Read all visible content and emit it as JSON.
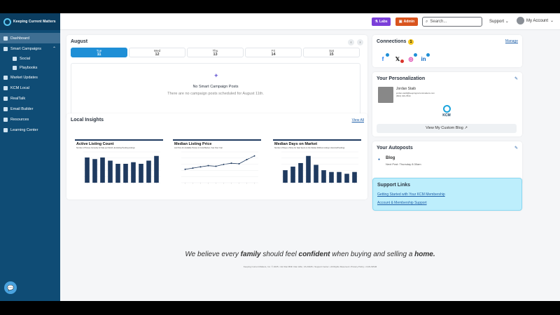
{
  "app": {
    "logo_text": "Keeping Current Matters"
  },
  "sidebar": {
    "items": [
      {
        "label": "Dashboard",
        "icon": "dashboard-icon"
      },
      {
        "label": "Smart Campaigns",
        "icon": "campaign-icon"
      },
      {
        "label": "Social",
        "icon": "social-icon"
      },
      {
        "label": "Playbooks",
        "icon": "playbook-icon"
      },
      {
        "label": "Market Updates",
        "icon": "market-icon"
      },
      {
        "label": "KCM Local",
        "icon": "location-icon"
      },
      {
        "label": "RealTalk",
        "icon": "realtalk-icon"
      },
      {
        "label": "Email Builder",
        "icon": "email-icon"
      },
      {
        "label": "Resources",
        "icon": "resources-icon"
      },
      {
        "label": "Learning Center",
        "icon": "learning-icon"
      }
    ]
  },
  "topbar": {
    "labs": "Labs",
    "admin": "Admin",
    "search_placeholder": "Search...",
    "support": "Support",
    "account": "My Account"
  },
  "calendar": {
    "title": "August",
    "days": [
      {
        "dow": "Tue",
        "num": "11"
      },
      {
        "dow": "Wed",
        "num": "12"
      },
      {
        "dow": "Thu",
        "num": "13"
      },
      {
        "dow": "Fri",
        "num": "14"
      },
      {
        "dow": "Sat",
        "num": "15"
      }
    ],
    "empty_title": "No Smart Campaign Posts",
    "empty_sub": "There are no campaign posts scheduled for August 11th."
  },
  "insights": {
    "title": "Local Insights",
    "view_all": "View All",
    "charts": [
      {
        "title": "Active Listing Count",
        "subtitle": "Number of Homes Currently for Sale per Month, Excluding Pending Listings"
      },
      {
        "title": "Median Listing Price",
        "subtitle": "List Price for Available Homes in Coral Market, Year Over Year"
      },
      {
        "title": "Median Days on Market",
        "subtitle": "Number of Days a Home for Sale Spent on the Market (Without Listing in Escrow/Pending)"
      }
    ]
  },
  "chart_data": [
    {
      "type": "bar",
      "title": "Active Listing Count",
      "values": [
        8,
        7.5,
        8,
        7,
        6,
        6,
        6.5,
        6,
        7,
        8.5
      ]
    },
    {
      "type": "line",
      "title": "Median Listing Price",
      "values": [
        2.2,
        2.4,
        2.6,
        2.8,
        2.7,
        3.0,
        3.2,
        3.1,
        3.8,
        4.4
      ],
      "labels": [
        "$415,000",
        "$432,400",
        "$443,400",
        "$445,800",
        "$461,400",
        "$460,000"
      ]
    },
    {
      "type": "bar",
      "title": "Median Days on Market",
      "values": [
        3.5,
        4.5,
        5.5,
        7.5,
        5,
        3.5,
        3,
        3,
        2.5,
        3
      ]
    }
  ],
  "connections": {
    "title": "Connections",
    "count": "1",
    "manage": "Manage",
    "networks": [
      "facebook-icon",
      "x-icon",
      "instagram-icon",
      "linkedin-icon"
    ]
  },
  "personalization": {
    "title": "Your Personalization",
    "name": "Jordan Staib",
    "email": "jordan.staib@keepingcurrentmatters.com",
    "phone": "(804) 319-7844",
    "logo_text": "KCM",
    "blog_button": "View My Custom Blog"
  },
  "autoposts": {
    "title": "Your Autoposts",
    "item": "Blog",
    "next": "Next Post: Thursday 8:30am"
  },
  "support_links": {
    "title": "Support Links",
    "links": [
      "Getting Started with Your KCM Membership",
      "Account & Membership Support"
    ]
  },
  "footer": {
    "quote_parts": [
      "We believe every ",
      "family",
      " should feel ",
      "confident",
      " when buying and selling a ",
      "home."
    ],
    "legal": "Keeping Current Matters, Inc. © 2025 • 112 Dan Bhlh Clan Hlbn, VA 23226 • Support Center • All Rights Reserved • Privacy Policy • CAN-SPAM"
  },
  "colors": {
    "sidebar": "#0f4c75",
    "accent": "#1f8fd6",
    "bar": "#1f3a5f",
    "labs": "#7b3fd9",
    "admin": "#d9541e",
    "support_bg": "#bdeefc"
  }
}
